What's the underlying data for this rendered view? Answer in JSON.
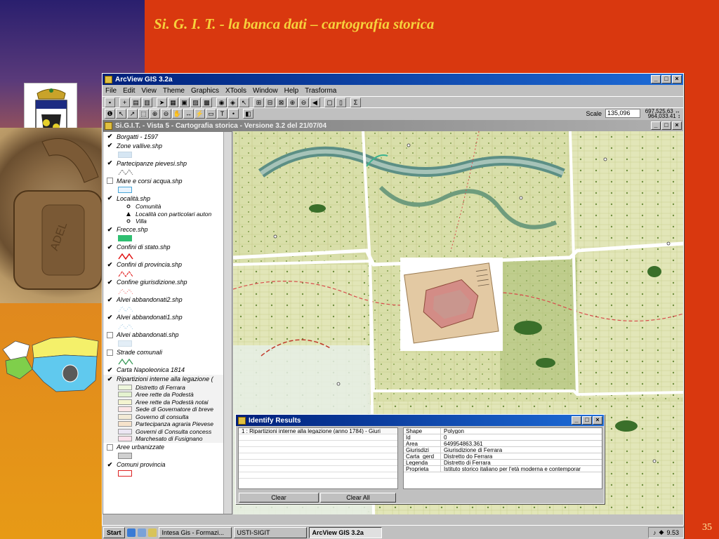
{
  "slide": {
    "title": "Si. G. I. T.  - la banca dati – cartografia storica",
    "number": "35"
  },
  "app": {
    "title": "ArcView GIS 3.2a",
    "menu": [
      "File",
      "Edit",
      "View",
      "Theme",
      "Graphics",
      "XTools",
      "Window",
      "Help",
      "Trasforma"
    ],
    "scale_label": "Scale",
    "scale_value": "135,096",
    "coord_x": "697,525.63",
    "coord_y": "964,033.41"
  },
  "view": {
    "title": "Si.G.I.T. - Vista 5 - Cartografia storica - Versione 3.2  del 21/07/04"
  },
  "toc": {
    "layers": [
      {
        "name": "Borgatti - 1597",
        "checked": true
      },
      {
        "name": "Zone vallive.shp",
        "checked": true
      },
      {
        "name": "Partecipanze pievesi.shp",
        "checked": true
      },
      {
        "name": "Mare e corsi acqua.shp",
        "checked": false
      },
      {
        "name": "Località.shp",
        "checked": true
      },
      {
        "name": "Frecce.shp",
        "checked": true
      },
      {
        "name": "Confini di stato.shp",
        "checked": true
      },
      {
        "name": "Confini di provincia.shp",
        "checked": true
      },
      {
        "name": "Confine giurisdizione.shp",
        "checked": true
      },
      {
        "name": "Alvei abbandonati2.shp",
        "checked": true
      },
      {
        "name": "Alvei abbandonati1.shp",
        "checked": true
      },
      {
        "name": "Alvei abbandonati.shp",
        "checked": false
      },
      {
        "name": "Strade comunali",
        "checked": false
      },
      {
        "name": "Carta Napoleonica  1814",
        "checked": true
      },
      {
        "name": "Ripartizioni interne alla legazione (",
        "checked": true
      },
      {
        "name": "Aree urbanizzate",
        "checked": false
      },
      {
        "name": "Comuni provincia",
        "checked": true
      }
    ],
    "localita_classes": [
      "Comunità",
      "Località con particolari auton",
      "Villa"
    ],
    "ripartizioni_classes": [
      {
        "label": "Distretto di Ferrara",
        "color": "#eef6dc"
      },
      {
        "label": "Aree rette da Podestà",
        "color": "#e4f2cf"
      },
      {
        "label": "Aree rette da Podestà notai",
        "color": "#f4f4d0"
      },
      {
        "label": "Sede di Governatore di breve",
        "color": "#fde6e6"
      },
      {
        "label": "Governo di consulta",
        "color": "#f3ead6"
      },
      {
        "label": "Partecipanza agraria Pievese",
        "color": "#f6e3cb"
      },
      {
        "label": "Governi di Consulta concess",
        "color": "#ece6f3"
      },
      {
        "label": "Marchesato di Fusignano",
        "color": "#fbe1ea"
      }
    ]
  },
  "identify": {
    "title": "Identify Results",
    "list_item": "1 : Ripartizioni interne alla legazione (anno 1784) - Giuri",
    "attributes": [
      {
        "key": "Shape",
        "value": "Polygon"
      },
      {
        "key": "Id",
        "value": "0"
      },
      {
        "key": "Area",
        "value": "649954863.361"
      },
      {
        "key": "Giurisdizi",
        "value": "Giurisdizione di Ferrara"
      },
      {
        "key": "Carta_gerd",
        "value": "Distretto do Ferrara"
      },
      {
        "key": "Legenda",
        "value": "Distretto di Ferrara"
      },
      {
        "key": "Proprieta",
        "value": "Istituto storico italiano per l'età moderna e contemporar"
      }
    ],
    "clear_label": "Clear",
    "clear_all_label": "Clear All"
  },
  "taskbar": {
    "start_label": "Start",
    "tasks": [
      "Intesa Gis - Formazi...",
      "USTI-SIGIT",
      "ArcView GIS 3.2a"
    ],
    "clock": "9.53"
  }
}
